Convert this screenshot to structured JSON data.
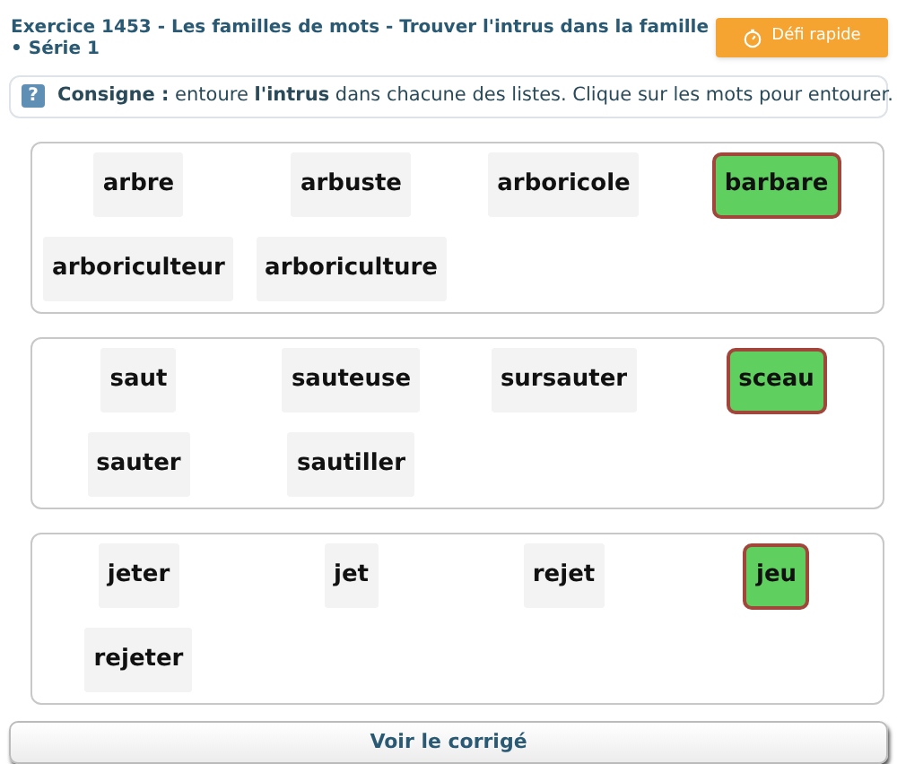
{
  "header": {
    "title": "Exercice 1453 - Les familles de mots - Trouver l'intrus dans la famille",
    "series": "• Série 1",
    "challenge_button": "Défi rapide"
  },
  "instruction": {
    "icon": "?",
    "text": "**Consigne :** entoure **l'intrus** dans chacune des listes. Clique sur les mots pour entourer."
  },
  "lists": [
    {
      "words": [
        {
          "label": "arbre",
          "selected": false
        },
        {
          "label": "arbuste",
          "selected": false
        },
        {
          "label": "arboricole",
          "selected": false
        },
        {
          "label": "barbare",
          "selected": true
        },
        {
          "label": "arboriculteur",
          "selected": false
        },
        {
          "label": "arboriculture",
          "selected": false
        }
      ]
    },
    {
      "words": [
        {
          "label": "saut",
          "selected": false
        },
        {
          "label": "sauteuse",
          "selected": false
        },
        {
          "label": "sursauter",
          "selected": false
        },
        {
          "label": "sceau",
          "selected": true
        },
        {
          "label": "sauter",
          "selected": false
        },
        {
          "label": "sautiller",
          "selected": false
        }
      ]
    },
    {
      "words": [
        {
          "label": "jeter",
          "selected": false
        },
        {
          "label": "jet",
          "selected": false
        },
        {
          "label": "rejet",
          "selected": false
        },
        {
          "label": "jeu",
          "selected": true
        },
        {
          "label": "rejeter",
          "selected": false
        }
      ]
    }
  ],
  "answer_button": "Voir le corrigé"
}
